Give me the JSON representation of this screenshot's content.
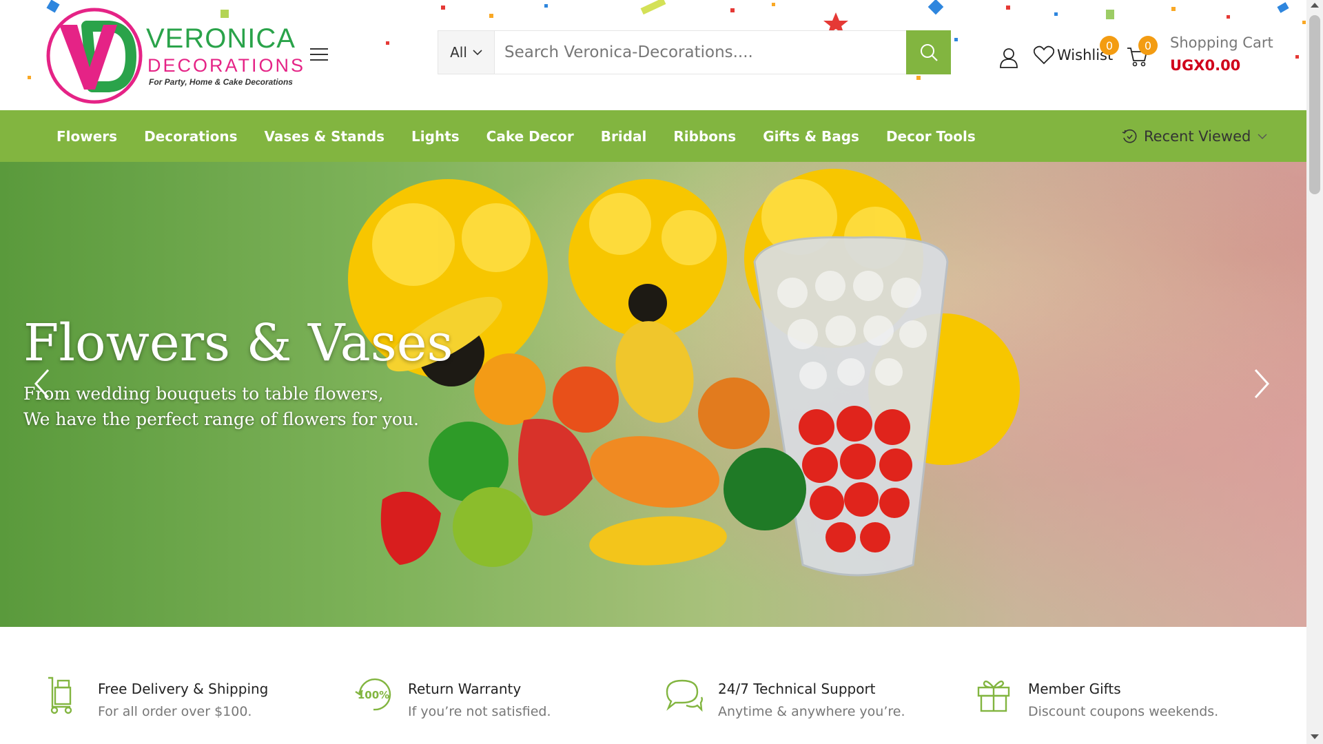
{
  "brand": {
    "name": "VERONICA",
    "sub": "DECORATIONS",
    "tagline": "For Party, Home & Cake Decorations",
    "colors": {
      "green": "#2aa34a",
      "pink": "#e52386",
      "accent": "#82b540",
      "price": "#d0021b",
      "badge": "#f39c12"
    }
  },
  "search": {
    "category": "All",
    "placeholder": "Search Veronica-Decorations....",
    "button_icon": "search-icon"
  },
  "header": {
    "account_icon": "user-icon",
    "wishlist_label": "Wishlist",
    "wishlist_count": "0",
    "cart_count": "0",
    "cart_label": "Shopping Cart",
    "cart_total": "UGX0.00"
  },
  "nav": {
    "items": [
      "Flowers",
      "Decorations",
      "Vases & Stands",
      "Lights",
      "Cake Decor",
      "Bridal",
      "Ribbons",
      "Gifts & Bags",
      "Decor Tools"
    ],
    "recent_label": "Recent Viewed"
  },
  "hero": {
    "title": "Flowers & Vases",
    "line1": "From wedding bouquets to table flowers,",
    "line2": "We have the perfect range of flowers for you."
  },
  "features": [
    {
      "icon": "delivery-trolley-icon",
      "title": "Free Delivery & Shipping",
      "desc": "For all order over $100."
    },
    {
      "icon": "warranty-100-icon",
      "title": "Return Warranty",
      "desc": "If you’re not satisfied."
    },
    {
      "icon": "chat-support-icon",
      "title": "24/7 Technical Support",
      "desc": "Anytime & anywhere you’re."
    },
    {
      "icon": "gift-icon",
      "title": "Member Gifts",
      "desc": "Discount coupons weekends."
    }
  ]
}
